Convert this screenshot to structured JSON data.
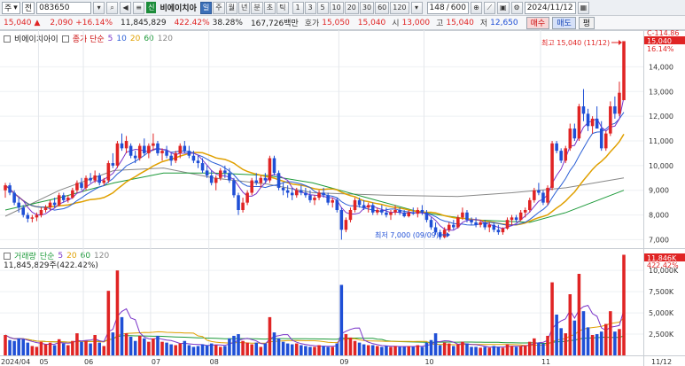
{
  "toolbar": {
    "market_select": "주",
    "mode_select": "전",
    "code": "083650",
    "tag": "신",
    "stock_name": "비에이치아",
    "period_buttons": [
      "일",
      "주",
      "월",
      "년",
      "분",
      "초",
      "틱"
    ],
    "minute_buttons": [
      "1",
      "3",
      "5",
      "10",
      "20",
      "30",
      "60",
      "120"
    ],
    "count": "148",
    "total": "600",
    "date": "2024/11/12"
  },
  "quote": {
    "price": "15,040",
    "change_arrow": "▲",
    "change": "2,090",
    "change_pct": "+16.14%",
    "volume": "11,845,829",
    "vol_ratio": "422.42%",
    "turnover": "38.28%",
    "amount": "167,726백만",
    "bid_label": "호가",
    "bid": "15,050",
    "ask": "15,040",
    "open_label": "시",
    "open": "13,000",
    "high_label": "고",
    "high": "15,040",
    "low_label": "저",
    "low": "12,650",
    "buy_label": "매수",
    "sell_label": "매도",
    "eval_label": "평"
  },
  "price_panel": {
    "name": "비에이치아이",
    "ma_label": "종가 단순",
    "ma_periods": [
      "5",
      "10",
      "20",
      "60",
      "120"
    ],
    "y_labels": [
      "14,000",
      "13,000",
      "12,000",
      "11,000",
      "10,000",
      "9,000",
      "8,000",
      "7,000"
    ],
    "top_label": "C-114.86",
    "current_label": "15,040",
    "current_pct": "16.14%",
    "max_annotation": "최고 15,040 (11/12)",
    "min_annotation": "최저 7,000 (09/09)"
  },
  "volume_panel": {
    "name": "거래량",
    "ma_label": "단순",
    "ma_periods": [
      "5",
      "20",
      "60",
      "120"
    ],
    "value_line": "11,845,829주(422.42%)",
    "y_labels": [
      "10,000K",
      "7,500K",
      "5,000K",
      "2,500K"
    ],
    "current_label": "11,846K",
    "current_pct": "422.42%"
  },
  "x_axis": [
    "2024/04",
    "05",
    "06",
    "07",
    "08",
    "09",
    "10",
    "11",
    "11/12"
  ],
  "colors": {
    "up": "#e02424",
    "down": "#1f4fd6",
    "ma5": "#7a35c9",
    "ma10": "#2b5fd6",
    "ma20": "#e0a000",
    "ma60": "#1d9a3a",
    "ma120": "#888888"
  },
  "chart_data": {
    "type": "candlestick",
    "ylim": [
      6800,
      15200
    ],
    "vol_ylim": [
      0,
      12000
    ],
    "candles": [
      [
        9000,
        9300,
        8700,
        9200,
        2400
      ],
      [
        9200,
        9300,
        8800,
        8900,
        1800
      ],
      [
        8900,
        9000,
        8400,
        8500,
        1700
      ],
      [
        8500,
        8700,
        8100,
        8300,
        2000
      ],
      [
        8300,
        8400,
        7900,
        8000,
        1900
      ],
      [
        8000,
        8100,
        7700,
        7850,
        1500
      ],
      [
        7850,
        8000,
        7700,
        7900,
        1100
      ],
      [
        7900,
        8100,
        7750,
        8000,
        1000
      ],
      [
        8000,
        8300,
        7900,
        8200,
        1600
      ],
      [
        8200,
        8400,
        8100,
        8300,
        1300
      ],
      [
        8300,
        8600,
        8200,
        8500,
        1500
      ],
      [
        8500,
        8700,
        8300,
        8400,
        1200
      ],
      [
        8400,
        8900,
        8350,
        8800,
        1900
      ],
      [
        8800,
        8900,
        8500,
        8600,
        1400
      ],
      [
        8600,
        8800,
        8500,
        8700,
        1200
      ],
      [
        8700,
        9100,
        8650,
        9000,
        1700
      ],
      [
        9000,
        9400,
        8900,
        9300,
        2600
      ],
      [
        9300,
        9500,
        9000,
        9100,
        1600
      ],
      [
        9100,
        9600,
        9000,
        9500,
        1700
      ],
      [
        9500,
        9700,
        9300,
        9400,
        1400
      ],
      [
        9400,
        9800,
        9300,
        9600,
        2400
      ],
      [
        9600,
        9700,
        9200,
        9300,
        1500
      ],
      [
        9300,
        9500,
        9200,
        9400,
        1100
      ],
      [
        9400,
        10200,
        9300,
        10100,
        7600
      ],
      [
        10100,
        10500,
        9900,
        10000,
        2700
      ],
      [
        10000,
        11000,
        9900,
        10900,
        10000
      ],
      [
        10900,
        11300,
        10600,
        10700,
        4500
      ],
      [
        10700,
        11200,
        10500,
        11000,
        2600
      ],
      [
        10800,
        10900,
        10300,
        10400,
        2200
      ],
      [
        10400,
        10600,
        10100,
        10300,
        1700
      ],
      [
        10300,
        10900,
        10200,
        10800,
        2300
      ],
      [
        10800,
        11100,
        10400,
        10500,
        2000
      ],
      [
        10500,
        10900,
        10300,
        10800,
        1600
      ],
      [
        10800,
        11300,
        10600,
        10900,
        2000
      ],
      [
        10900,
        11000,
        10400,
        10500,
        2300
      ],
      [
        10500,
        10700,
        10200,
        10600,
        1600
      ],
      [
        10600,
        10800,
        10300,
        10400,
        1500
      ],
      [
        10400,
        10500,
        10000,
        10200,
        1300
      ],
      [
        10200,
        10600,
        10100,
        10500,
        1200
      ],
      [
        10500,
        10900,
        10300,
        10800,
        1400
      ],
      [
        10800,
        11000,
        10500,
        10600,
        1700
      ],
      [
        10600,
        10800,
        10300,
        10400,
        1200
      ],
      [
        10400,
        10600,
        10100,
        10200,
        1000
      ],
      [
        10200,
        10400,
        9900,
        10100,
        1100
      ],
      [
        10100,
        10300,
        9700,
        9800,
        1300
      ],
      [
        9800,
        10000,
        9500,
        9600,
        1200
      ],
      [
        9600,
        9800,
        9200,
        9300,
        1400
      ],
      [
        9300,
        9600,
        9000,
        9500,
        1200
      ],
      [
        9500,
        9900,
        9400,
        9800,
        1000
      ],
      [
        9800,
        10000,
        9500,
        9700,
        1100
      ],
      [
        9700,
        9900,
        9300,
        9400,
        2000
      ],
      [
        9400,
        9500,
        8700,
        8800,
        2300
      ],
      [
        8800,
        8900,
        8000,
        8200,
        2500
      ],
      [
        8200,
        8700,
        8100,
        8500,
        1700
      ],
      [
        8500,
        9000,
        8400,
        8900,
        1500
      ],
      [
        8900,
        9500,
        8800,
        9400,
        1300
      ],
      [
        9400,
        9700,
        9200,
        9300,
        1500
      ],
      [
        9300,
        9600,
        9100,
        9500,
        1000
      ],
      [
        9500,
        9700,
        9300,
        9400,
        1400
      ],
      [
        9400,
        10400,
        9300,
        10300,
        4500
      ],
      [
        10300,
        10400,
        9600,
        9700,
        2700
      ],
      [
        9700,
        9800,
        9000,
        9100,
        2000
      ],
      [
        9100,
        9300,
        8800,
        9000,
        1600
      ],
      [
        9000,
        9200,
        8700,
        8900,
        1400
      ],
      [
        8900,
        9100,
        8600,
        8800,
        1300
      ],
      [
        8800,
        9100,
        8700,
        9000,
        1400
      ],
      [
        9000,
        9200,
        8800,
        8900,
        1200
      ],
      [
        8900,
        9100,
        8700,
        8800,
        1100
      ],
      [
        8800,
        9000,
        8500,
        8600,
        1000
      ],
      [
        8600,
        8800,
        8400,
        8700,
        1000
      ],
      [
        8700,
        9000,
        8600,
        8900,
        1200
      ],
      [
        8900,
        9100,
        8700,
        8800,
        1100
      ],
      [
        8800,
        8900,
        8400,
        8500,
        1000
      ],
      [
        8500,
        8700,
        8300,
        8600,
        1000
      ],
      [
        8600,
        8700,
        8100,
        8200,
        1400
      ],
      [
        8200,
        8300,
        7000,
        7400,
        8300
      ],
      [
        7400,
        7900,
        7300,
        7800,
        2500
      ],
      [
        7800,
        8300,
        7700,
        8200,
        2100
      ],
      [
        8200,
        8700,
        8100,
        8600,
        1700
      ],
      [
        8600,
        8700,
        8300,
        8400,
        1500
      ],
      [
        8400,
        8600,
        8200,
        8300,
        1300
      ],
      [
        8300,
        8500,
        8100,
        8400,
        1200
      ],
      [
        8400,
        8500,
        8000,
        8100,
        1200
      ],
      [
        8100,
        8300,
        8000,
        8200,
        1100
      ],
      [
        8200,
        8400,
        8000,
        8100,
        1000
      ],
      [
        8100,
        8300,
        7900,
        8000,
        1100
      ],
      [
        8000,
        8200,
        7800,
        8100,
        1000
      ],
      [
        8100,
        8400,
        8000,
        8200,
        1100
      ],
      [
        8200,
        8300,
        8000,
        8100,
        1000
      ],
      [
        8100,
        8200,
        7900,
        7950,
        1000
      ],
      [
        7950,
        8200,
        7900,
        8100,
        1100
      ],
      [
        8100,
        8300,
        8000,
        8050,
        1000
      ],
      [
        8050,
        8300,
        7900,
        8200,
        1200
      ],
      [
        8200,
        8400,
        8000,
        8100,
        1000
      ],
      [
        8100,
        8200,
        7700,
        7800,
        1500
      ],
      [
        7800,
        7900,
        7400,
        7500,
        1800
      ],
      [
        7500,
        7700,
        7200,
        7300,
        2600
      ],
      [
        7300,
        7400,
        7000,
        7100,
        1200
      ],
      [
        7100,
        7500,
        7050,
        7400,
        1500
      ],
      [
        7400,
        7700,
        7300,
        7600,
        1400
      ],
      [
        7600,
        7800,
        7400,
        7500,
        1100
      ],
      [
        7500,
        8000,
        7450,
        7900,
        1300
      ],
      [
        7900,
        8300,
        7800,
        8100,
        1600
      ],
      [
        8100,
        8200,
        7700,
        7800,
        1400
      ],
      [
        7800,
        7900,
        7600,
        7700,
        1000
      ],
      [
        7700,
        7900,
        7500,
        7600,
        1000
      ],
      [
        7600,
        7800,
        7500,
        7700,
        900
      ],
      [
        7700,
        7800,
        7400,
        7500,
        1000
      ],
      [
        7500,
        7700,
        7300,
        7600,
        900
      ],
      [
        7600,
        7700,
        7300,
        7400,
        1100
      ],
      [
        7400,
        7600,
        7200,
        7300,
        1000
      ],
      [
        7300,
        7500,
        7200,
        7450,
        900
      ],
      [
        7450,
        7900,
        7400,
        7800,
        1300
      ],
      [
        7800,
        8000,
        7600,
        7900,
        1100
      ],
      [
        7900,
        8000,
        7700,
        7800,
        1000
      ],
      [
        7800,
        8200,
        7750,
        8100,
        1100
      ],
      [
        8100,
        8300,
        7900,
        8200,
        1200
      ],
      [
        8200,
        8700,
        8100,
        8600,
        1600
      ],
      [
        8600,
        9100,
        8500,
        9000,
        2000
      ],
      [
        9000,
        9300,
        8800,
        8900,
        1500
      ],
      [
        8900,
        9000,
        8400,
        8500,
        1400
      ],
      [
        8500,
        9200,
        8400,
        9100,
        2300
      ],
      [
        9100,
        11000,
        9000,
        10900,
        8600
      ],
      [
        10900,
        11000,
        10500,
        10600,
        4800
      ],
      [
        10600,
        10700,
        10100,
        10200,
        3200
      ],
      [
        10200,
        10800,
        10100,
        10700,
        2600
      ],
      [
        10700,
        11700,
        10600,
        11500,
        7200
      ],
      [
        11500,
        11700,
        11000,
        11100,
        4100
      ],
      [
        11100,
        12500,
        11000,
        12400,
        9600
      ],
      [
        12400,
        13100,
        11800,
        12100,
        5200
      ],
      [
        12100,
        12300,
        11400,
        11600,
        3300
      ],
      [
        11600,
        12000,
        11300,
        11900,
        2400
      ],
      [
        11900,
        12400,
        11600,
        11500,
        2500
      ],
      [
        11500,
        11800,
        10600,
        10700,
        2800
      ],
      [
        10700,
        11400,
        10600,
        11300,
        3700
      ],
      [
        11300,
        12600,
        11200,
        12400,
        5200
      ],
      [
        12400,
        12800,
        11900,
        12100,
        2800
      ],
      [
        12100,
        13400,
        12000,
        12950,
        3100
      ],
      [
        12650,
        15040,
        12650,
        15040,
        11846
      ]
    ],
    "ma120": [
      [
        0,
        7950
      ],
      [
        60,
        9000
      ],
      [
        120,
        9800
      ],
      [
        175,
        9900
      ],
      [
        230,
        9500
      ],
      [
        290,
        9250
      ],
      [
        340,
        8900
      ],
      [
        420,
        8800
      ],
      [
        500,
        8750
      ],
      [
        560,
        8900
      ],
      [
        620,
        9100
      ],
      [
        684,
        9500
      ]
    ],
    "ma60": [
      [
        0,
        8200
      ],
      [
        60,
        8700
      ],
      [
        120,
        9300
      ],
      [
        175,
        9700
      ],
      [
        230,
        9700
      ],
      [
        290,
        9600
      ],
      [
        340,
        9300
      ],
      [
        400,
        8700
      ],
      [
        460,
        8100
      ],
      [
        520,
        7800
      ],
      [
        580,
        7700
      ],
      [
        620,
        8100
      ],
      [
        684,
        9000
      ]
    ]
  }
}
